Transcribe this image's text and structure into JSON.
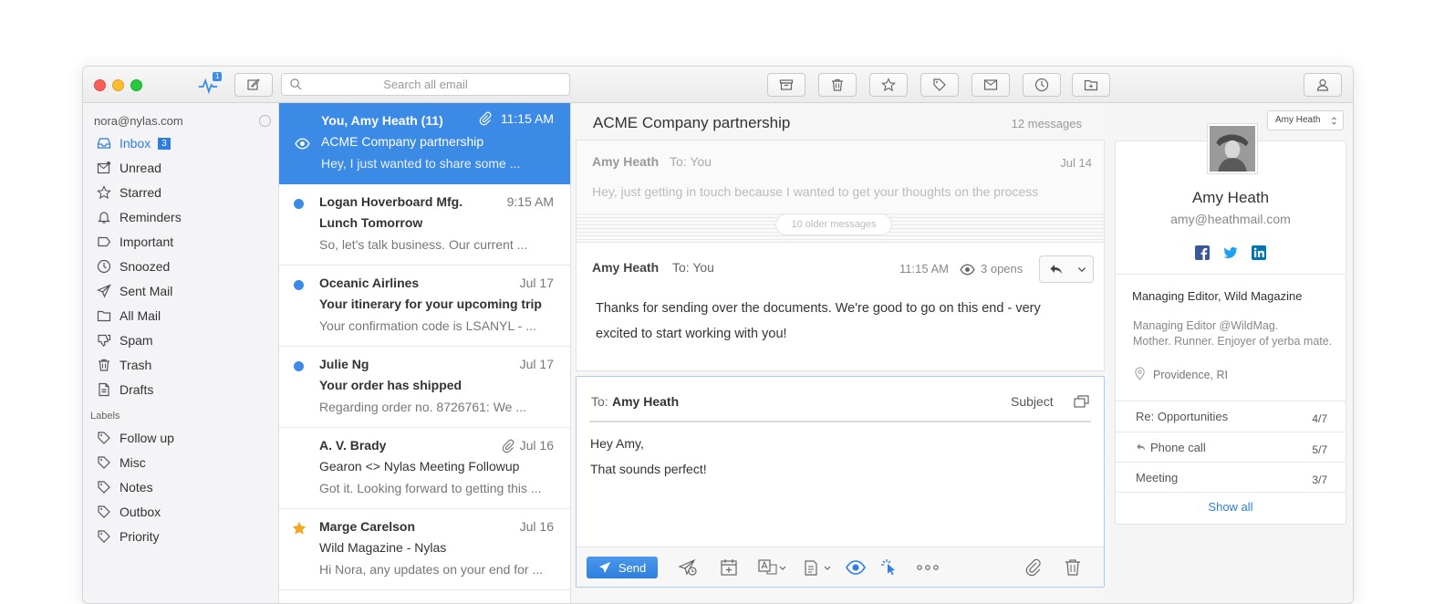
{
  "titlebar": {
    "activity_badge": "1",
    "search_placeholder": "Search all email",
    "toolbar_icons": [
      "archive-icon",
      "trash-icon",
      "star-icon",
      "tag-icon",
      "move-icon",
      "clock-icon",
      "folder-icon"
    ],
    "profile_icon": "user-icon"
  },
  "sidebar": {
    "account": "nora@nylas.com",
    "items": [
      {
        "label": "Inbox",
        "icon": "inbox-icon",
        "badge": "3",
        "active": true
      },
      {
        "label": "Unread",
        "icon": "unread-icon"
      },
      {
        "label": "Starred",
        "icon": "star-icon"
      },
      {
        "label": "Reminders",
        "icon": "bell-icon"
      },
      {
        "label": "Important",
        "icon": "important-icon"
      },
      {
        "label": "Snoozed",
        "icon": "clock-icon"
      },
      {
        "label": "Sent Mail",
        "icon": "send-icon"
      },
      {
        "label": "All Mail",
        "icon": "folder-icon"
      },
      {
        "label": "Spam",
        "icon": "thumbs-down-icon"
      },
      {
        "label": "Trash",
        "icon": "trash-icon"
      },
      {
        "label": "Drafts",
        "icon": "draft-icon"
      }
    ],
    "labels_heading": "Labels",
    "labels": [
      "Follow up",
      "Misc",
      "Notes",
      "Outbox",
      "Priority"
    ]
  },
  "threads": [
    {
      "from": "You, Amy Heath (11)",
      "date": "11:15 AM",
      "subject": "ACME Company partnership",
      "snippet": "Hey, I just wanted to share some ...",
      "selected": true,
      "attachment": true,
      "seen": true
    },
    {
      "from": "Logan Hoverboard Mfg.",
      "date": "9:15 AM",
      "subject": "Lunch Tomorrow",
      "snippet": "So, let's talk business. Our current ...",
      "unread": true
    },
    {
      "from": "Oceanic Airlines",
      "date": "Jul 17",
      "subject": "Your itinerary for your upcoming trip",
      "snippet": "Your confirmation code is LSANYL - ...",
      "unread": true
    },
    {
      "from": "Julie Ng",
      "date": "Jul 17",
      "subject": "Your order has shipped",
      "snippet": "Regarding order no. 8726761: We ...",
      "unread": true
    },
    {
      "from": "A. V. Brady",
      "date": "Jul 16",
      "subject": "Gearon <> Nylas Meeting Followup",
      "snippet": "Got it. Looking forward to getting this ...",
      "attachment": true
    },
    {
      "from": "Marge Carelson",
      "date": "Jul 16",
      "subject": "Wild Magazine - Nylas",
      "snippet": "Hi Nora, any updates on your end for ...",
      "starred": true
    }
  ],
  "reader": {
    "title": "ACME Company partnership",
    "count": "12 messages",
    "collapsed": {
      "from": "Amy Heath",
      "to": "To: You",
      "date": "Jul 14",
      "snippet": "Hey, just getting in touch because I wanted to get your thoughts on the process"
    },
    "older": "10 older messages",
    "expanded": {
      "from": "Amy Heath",
      "to": "To: You",
      "time": "11:15 AM",
      "opens": "3 opens",
      "body1": "Thanks for sending over the documents. We're good to go on this end - very",
      "body2": "excited to start working with you!"
    },
    "composer": {
      "to_label": "To:",
      "to_name": "Amy Heath",
      "subject_label": "Subject",
      "line1": "Hey Amy,",
      "line2": "That sounds perfect!",
      "send": "Send"
    }
  },
  "contact": {
    "selector": "Amy Heath",
    "name": "Amy Heath",
    "email": "amy@heathmail.com",
    "title": "Managing Editor, Wild Magazine",
    "bio1": "Managing Editor @WildMag.",
    "bio2": "Mother. Runner. Enjoyer of yerba mate.",
    "location": "Providence, RI",
    "related": [
      {
        "label": "Re: Opportunities",
        "count": "4/7"
      },
      {
        "label": "Phone call",
        "count": "5/7",
        "reply": true
      },
      {
        "label": "Meeting",
        "count": "3/7"
      }
    ],
    "show_all": "Show all",
    "colors": {
      "facebook": "#3b5998",
      "twitter": "#1da1f2",
      "linkedin": "#0077b5",
      "accent": "#2e7de0"
    }
  }
}
